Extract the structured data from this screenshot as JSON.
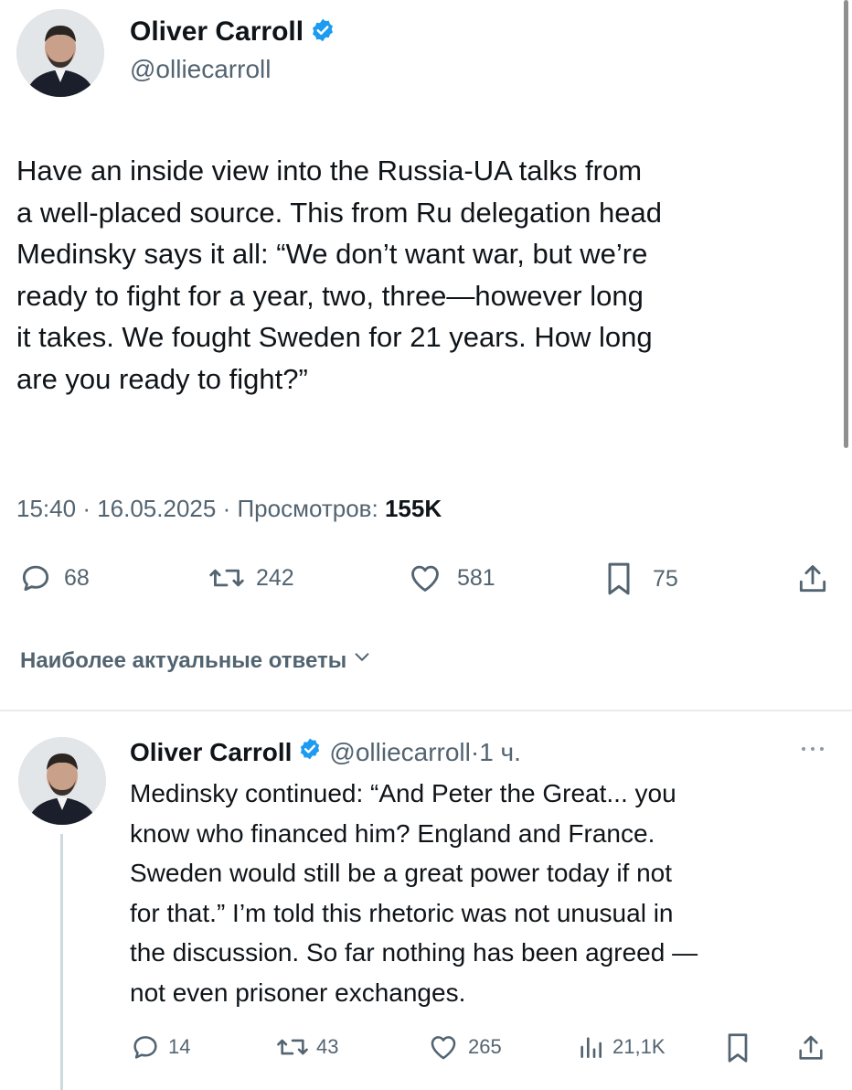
{
  "main_tweet": {
    "author_name": "Oliver Carroll",
    "author_handle": "@olliecarroll",
    "text": "Have an inside view into the Russia-UA talks from\na well-placed source. This from Ru delegation head\nMedinsky says it all: “We don’t want war, but we’re\nready to fight for a year, two, three—however long\nit takes. We fought Sweden for 21 years. How long\nare you ready to fight?”",
    "time": "15:40",
    "date": "16.05.2025",
    "views_label": "Просмотров:",
    "views_count": "155K",
    "replies": "68",
    "reposts": "242",
    "likes": "581",
    "bookmarks": "75"
  },
  "replies_sort": {
    "label": "Наиболее актуальные ответы"
  },
  "reply_tweet": {
    "author_name": "Oliver Carroll",
    "author_handle": "@olliecarroll",
    "age": "1 ч.",
    "text": "Medinsky continued: “And Peter the Great... you\nknow who financed him? England and France.\nSweden would still be a great power today if not\nfor that.” I’m told this rhetoric was not unusual in\nthe discussion. So far nothing has been agreed —\nnot even prisoner exchanges.",
    "replies": "14",
    "reposts": "43",
    "likes": "265",
    "views": "21,1K"
  },
  "icons": {
    "verified": "verified-badge-icon",
    "reply": "speech-bubble-icon",
    "repost": "repost-arrows-icon",
    "like": "heart-icon",
    "bookmark": "bookmark-icon",
    "share": "share-upload-icon",
    "views": "bar-chart-icon",
    "more": "more-dots-icon",
    "sort": "chevron-down-icon"
  },
  "colors": {
    "verified_blue": "#1d9bf0",
    "text_primary": "#0f1419",
    "text_secondary": "#536471"
  }
}
